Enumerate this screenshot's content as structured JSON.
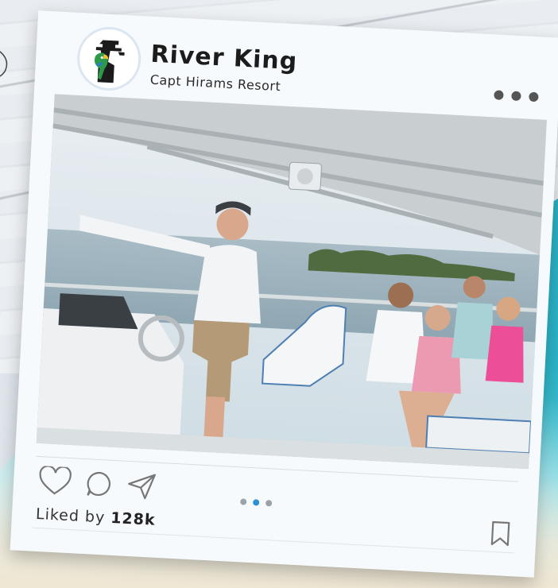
{
  "post": {
    "account_name": "River King",
    "account_subtitle": "Capt Hirams Resort",
    "avatar_icon": "parrot-logo-icon",
    "more_icon": "more-options-icon",
    "liked_prefix": "Liked by",
    "like_count": "128k",
    "carousel": {
      "total": 3,
      "active_index": 1
    },
    "actions": [
      "heart-icon",
      "comment-icon",
      "share-icon",
      "bookmark-icon"
    ]
  },
  "colors": {
    "card": "#f7fafd",
    "accent": "#2b8fd3",
    "text": "#1c1c1c"
  }
}
